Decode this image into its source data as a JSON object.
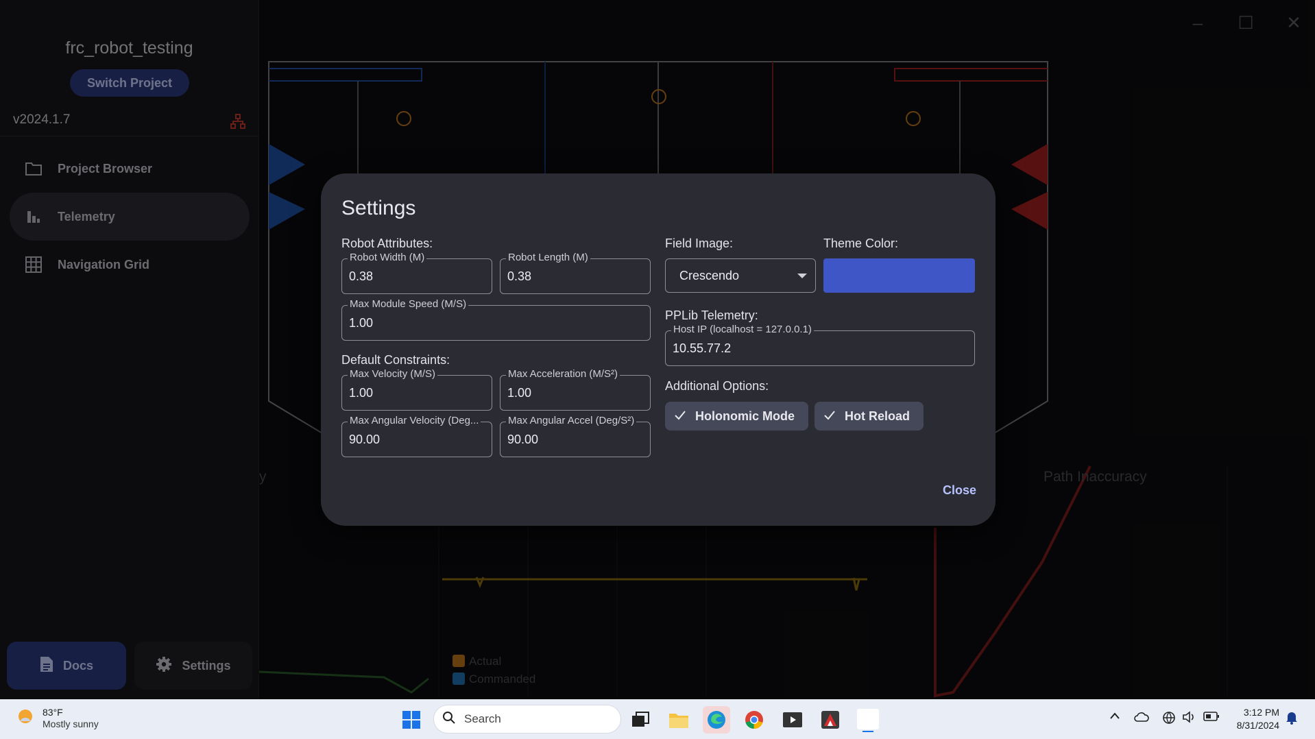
{
  "sidebar": {
    "project_name": "frc_robot_testing",
    "switch_project": "Switch Project",
    "version": "v2024.1.7",
    "nav": [
      {
        "label": "Project Browser",
        "icon": "folder-icon"
      },
      {
        "label": "Telemetry",
        "icon": "bar-chart-icon",
        "active": true
      },
      {
        "label": "Navigation Grid",
        "icon": "grid-icon"
      }
    ],
    "docs": "Docs",
    "settings": "Settings"
  },
  "background": {
    "chart_left_title_fragment": "y",
    "chart_right_title": "Path Inaccuracy",
    "legend": [
      {
        "label": "Actual",
        "color": "#b8741a"
      },
      {
        "label": "Commanded",
        "color": "#1f6fb0"
      }
    ]
  },
  "dialog": {
    "title": "Settings",
    "robot_attributes": {
      "label": "Robot Attributes:",
      "robot_width": {
        "label": "Robot Width (M)",
        "value": "0.38"
      },
      "robot_length": {
        "label": "Robot Length (M)",
        "value": "0.38"
      },
      "max_module_speed": {
        "label": "Max Module Speed (M/S)",
        "value": "1.00"
      }
    },
    "default_constraints": {
      "label": "Default Constraints:",
      "max_velocity": {
        "label": "Max Velocity (M/S)",
        "value": "1.00"
      },
      "max_acceleration": {
        "label": "Max Acceleration (M/S²)",
        "value": "1.00"
      },
      "max_angular_velocity": {
        "label": "Max Angular Velocity (Deg...",
        "value": "90.00"
      },
      "max_angular_accel": {
        "label": "Max Angular Accel (Deg/S²)",
        "value": "90.00"
      }
    },
    "field_image": {
      "label": "Field Image:",
      "value": "Crescendo"
    },
    "theme_color": {
      "label": "Theme Color:",
      "color": "#3f56c6"
    },
    "pplib_telemetry": {
      "label": "PPLib Telemetry:",
      "host_ip": {
        "label": "Host IP (localhost = 127.0.0.1)",
        "value": "10.55.77.2"
      }
    },
    "additional_options": {
      "label": "Additional Options:",
      "holonomic_mode": "Holonomic Mode",
      "hot_reload": "Hot Reload"
    },
    "close": "Close"
  },
  "taskbar": {
    "weather_temp": "83°F",
    "weather_desc": "Mostly sunny",
    "search_placeholder": "Search",
    "time": "3:12 PM",
    "date": "8/31/2024"
  },
  "colors": {
    "accent": "#2d3a7d",
    "theme": "#3f56c6",
    "dialog_bg": "#2a2b33",
    "chip_bg": "#454858"
  }
}
